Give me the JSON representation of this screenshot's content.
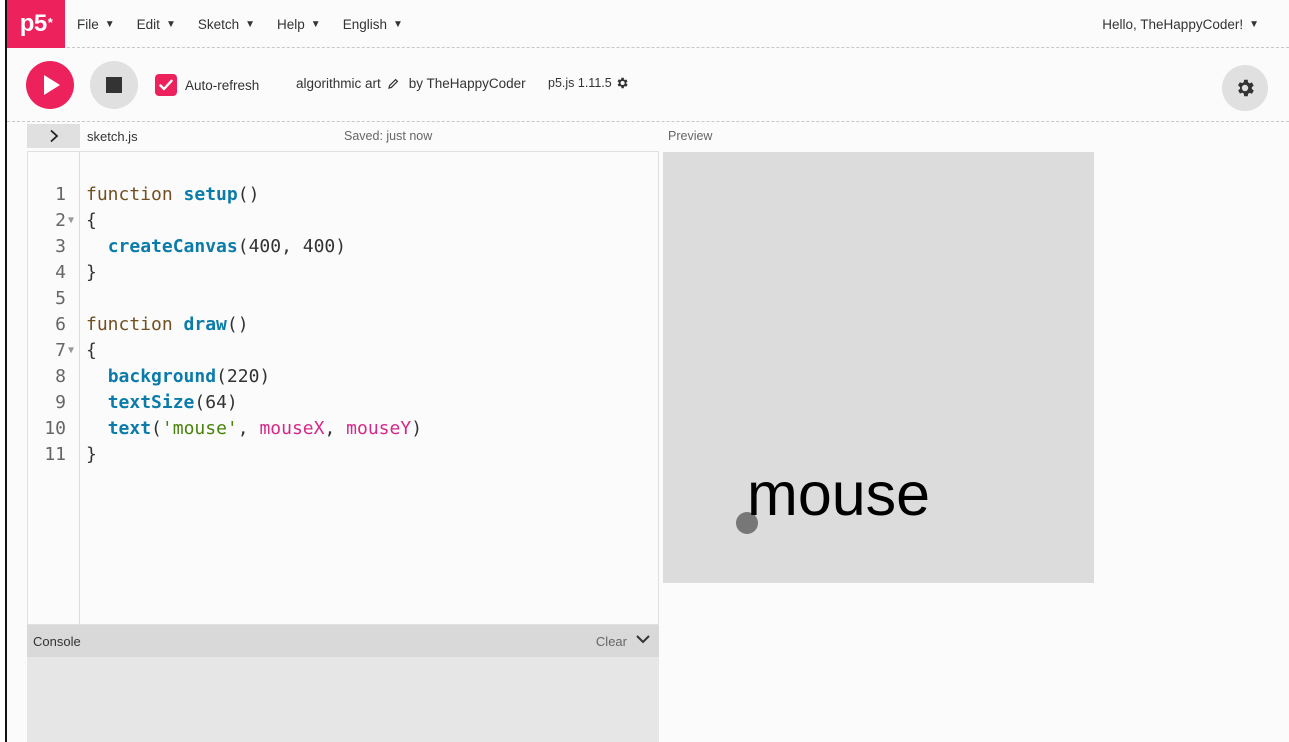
{
  "nav": {
    "logo": "p5",
    "logo_sup": "*",
    "menus": [
      "File",
      "Edit",
      "Sketch",
      "Help",
      "English"
    ],
    "user_greeting": "Hello, TheHappyCoder!"
  },
  "toolbar": {
    "auto_refresh_label": "Auto-refresh",
    "auto_refresh_checked": true,
    "project_name": "algorithmic art",
    "author": "by TheHappyCoder",
    "version": "p5.js 1.11.5"
  },
  "editor": {
    "filename": "sketch.js",
    "save_status": "Saved: just now",
    "lines": [
      {
        "n": "1",
        "fold": ""
      },
      {
        "n": "2",
        "fold": "▼"
      },
      {
        "n": "3",
        "fold": ""
      },
      {
        "n": "4",
        "fold": ""
      },
      {
        "n": "5",
        "fold": ""
      },
      {
        "n": "6",
        "fold": ""
      },
      {
        "n": "7",
        "fold": "▼"
      },
      {
        "n": "8",
        "fold": ""
      },
      {
        "n": "9",
        "fold": ""
      },
      {
        "n": "10",
        "fold": ""
      },
      {
        "n": "11",
        "fold": ""
      }
    ],
    "code": {
      "l1_kw": "function ",
      "l1_fn": "setup",
      "l1_rest": "()",
      "l2": "{",
      "l3_indent": "  ",
      "l3_fn": "createCanvas",
      "l3_rest": "(400, 400)",
      "l4": "}",
      "l5": "",
      "l6_kw": "function ",
      "l6_fn": "draw",
      "l6_rest": "()",
      "l7": "{",
      "l8_indent": "  ",
      "l8_fn": "background",
      "l8_rest": "(220)",
      "l9_indent": "  ",
      "l9_fn": "textSize",
      "l9_rest": "(64)",
      "l10_indent": "  ",
      "l10_fn": "text",
      "l10_p1": "(",
      "l10_str": "'mouse'",
      "l10_p2": ", ",
      "l10_v1": "mouseX",
      "l10_p3": ", ",
      "l10_v2": "mouseY",
      "l10_p4": ")",
      "l11": "}"
    }
  },
  "console": {
    "title": "Console",
    "clear_label": "Clear"
  },
  "preview": {
    "label": "Preview",
    "canvas_text": "mouse",
    "canvas_bg": "#dcdcdc"
  },
  "colors": {
    "accent": "#ed225d",
    "keyword": "#704f21",
    "function": "#0b7ca9",
    "string": "#47820a",
    "variable": "#d52889"
  }
}
